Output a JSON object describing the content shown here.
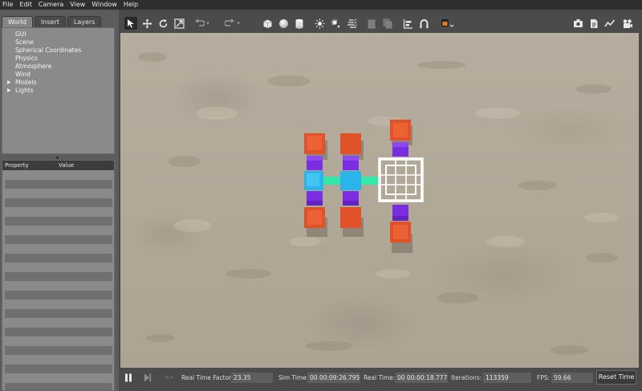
{
  "menu": [
    "File",
    "Edit",
    "Camera",
    "View",
    "Window",
    "Help"
  ],
  "left_panel": {
    "tabs": [
      "World",
      "Insert",
      "Layers"
    ],
    "active_tab": "World",
    "tree": {
      "items": [
        "GUI",
        "Scene",
        "Spherical Coordinates",
        "Physics",
        "Atmosphere",
        "Wind",
        "Models",
        "Lights"
      ],
      "expandable": [
        "Models",
        "Lights"
      ]
    },
    "properties": {
      "col_property": "Property",
      "col_value": "Value"
    }
  },
  "toolbar": {
    "left_icons": [
      "select-arrow-icon",
      "translate-icon",
      "rotate-icon",
      "scale-icon",
      "undo-icon",
      "undo-dropdown-icon",
      "redo-icon",
      "redo-dropdown-icon",
      "box-icon",
      "sphere-icon",
      "cylinder-icon",
      "point-light-icon",
      "spot-light-icon",
      "directional-light-icon",
      "copy-icon",
      "paste-icon",
      "align-icon",
      "snap-icon",
      "view-angle-icon"
    ],
    "right_icons": [
      "screenshot-icon",
      "log-icon",
      "plot-icon",
      "video-record-icon"
    ]
  },
  "bottom": {
    "real_time_factor_label": "Real Time Factor:",
    "real_time_factor": "23.35",
    "sim_time_label": "Sim Time:",
    "sim_time": "00 00:09:26.795",
    "real_time_label": "Real Time:",
    "real_time": "00 00:00:18.777",
    "iterations_label": "Iterations:",
    "iterations": "113359",
    "fps_label": "FPS:",
    "fps": "59.66",
    "reset_label": "Reset Time"
  },
  "colors": {
    "module_red": "#e0522a",
    "module_purple": "#7a2ee0",
    "module_cyan": "#2ab4ea",
    "connector_green": "#33e8a8",
    "frame_white": "#ffffff"
  }
}
